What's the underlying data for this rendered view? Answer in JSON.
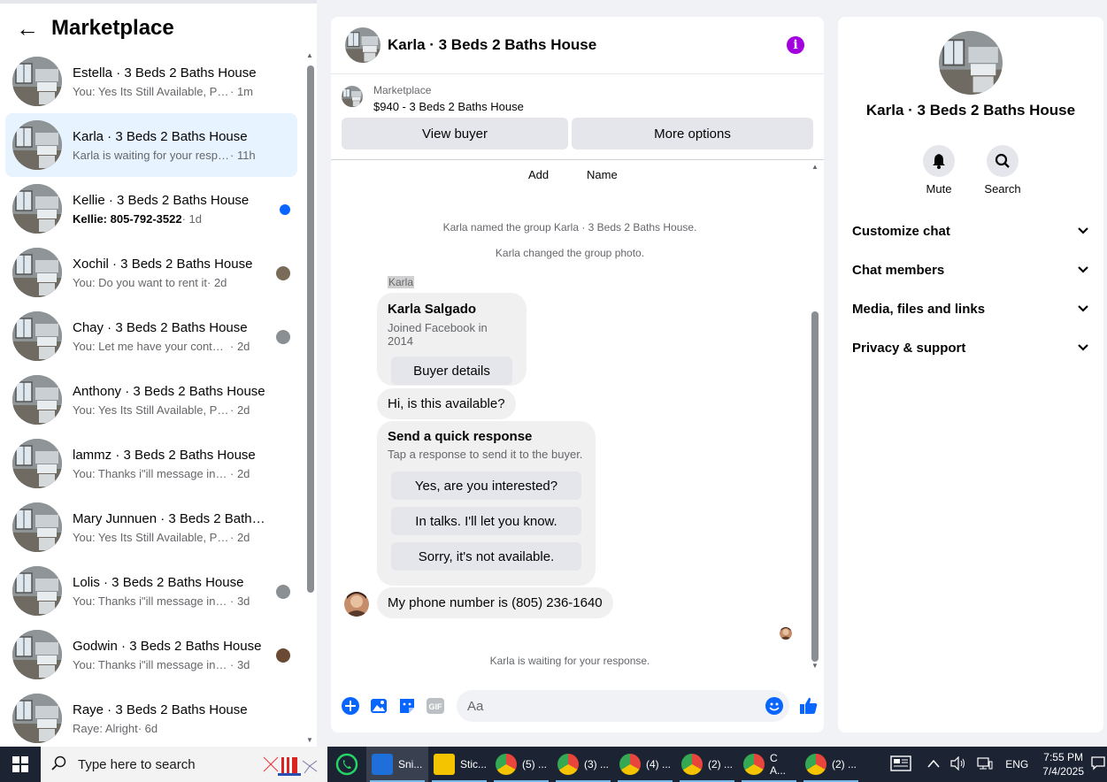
{
  "left": {
    "title": "Marketplace",
    "conversations": [
      {
        "name": "Estella · 3 Beds 2 Baths House",
        "snippet": "You: Yes Its Still Available, Please S...",
        "time": " · 1m",
        "marker": "none"
      },
      {
        "name": "Karla · 3 Beds 2 Baths House",
        "snippet": "Karla is waiting for your response.",
        "time": " · 11h",
        "marker": "none"
      },
      {
        "name": "Kellie · 3 Beds 2 Baths House",
        "snippet": "Kellie: 805-792-3522",
        "time": " · 1d",
        "marker": "unread"
      },
      {
        "name": "Xochil · 3 Beds 2 Baths House",
        "snippet": "You: Do you want to rent it",
        "time": " · 2d",
        "marker": "avatar"
      },
      {
        "name": "Chay · 3 Beds 2 Baths House",
        "snippet": "You: Let me have your contact n...",
        "time": " · 2d",
        "marker": "avatar"
      },
      {
        "name": "Anthony · 3 Beds 2 Baths House",
        "snippet": "You: Yes Its Still Available, Please Se...",
        "time": " · 2d",
        "marker": "none"
      },
      {
        "name": "lammz · 3 Beds 2 Baths House",
        "snippet": "You: Thanks i\"ill message in a mom...",
        "time": " · 2d",
        "marker": "none"
      },
      {
        "name": "Mary Junnuen · 3 Beds 2 Baths ...",
        "snippet": "You: Yes Its Still Available, Please Se...",
        "time": " · 2d",
        "marker": "none"
      },
      {
        "name": "Lolis · 3 Beds 2 Baths House",
        "snippet": "You: Thanks i\"ill message in a m...",
        "time": " · 3d",
        "marker": "avatar"
      },
      {
        "name": "Godwin · 3 Beds 2 Baths House",
        "snippet": "You: Thanks i\"ill message in a m...",
        "time": " · 3d",
        "marker": "avatar"
      },
      {
        "name": "Raye · 3 Beds 2 Baths House",
        "snippet": "Raye: Alright",
        "time": " · 6d",
        "marker": "none"
      }
    ]
  },
  "chat": {
    "title": "Karla · 3 Beds 2 Baths House",
    "listing_label": "Marketplace",
    "listing_price": "$940 - 3 Beds 2 Baths House",
    "view_buyer": "View buyer",
    "more_options": "More options",
    "add_label": "Add",
    "name_label": "Name",
    "sys_named": "Karla named the group Karla · 3 Beds 2 Baths House.",
    "sys_photo": "Karla changed the group photo.",
    "sender": "Karla",
    "profile_name": "Karla Salgado",
    "profile_joined": "Joined Facebook in 2014",
    "buyer_details": "Buyer details",
    "msg_hi": "Hi, is this available?",
    "quick_title": "Send a quick response",
    "quick_sub": "Tap a response to send it to the buyer.",
    "quick_responses": [
      "Yes, are you interested?",
      "In talks. I'll let you know.",
      "Sorry, it's not available."
    ],
    "msg_phone": "My phone number is (805) 236-1640",
    "waiting": "Karla is waiting for your response.",
    "input_placeholder": "Aa"
  },
  "details": {
    "name": "Karla · 3 Beds 2 Baths House",
    "mute": "Mute",
    "search": "Search",
    "sections": [
      "Customize chat",
      "Chat members",
      "Media, files and links",
      "Privacy & support"
    ]
  },
  "taskbar": {
    "search_placeholder": "Type here to search",
    "items": [
      "Sni...",
      "Stic...",
      "(5) ...",
      "(3) ...",
      "(4) ...",
      "(2) ...",
      "C A...",
      "(2) ..."
    ],
    "lang": "ENG",
    "time": "7:55 PM",
    "date": "7/4/2025"
  },
  "colors": {
    "accent": "#0866ff",
    "info": "#a300e0",
    "active_row": "#e7f3ff"
  }
}
